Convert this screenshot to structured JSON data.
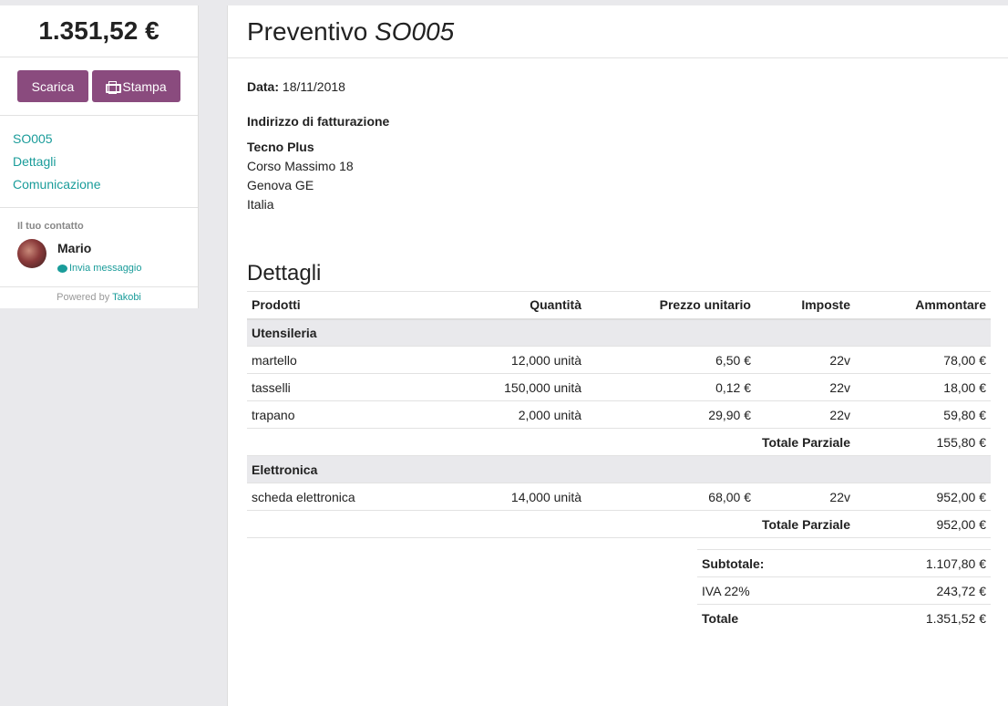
{
  "sidebar": {
    "amount": "1.351,52 €",
    "buttons": {
      "download": "Scarica",
      "print": "Stampa"
    },
    "nav": [
      "SO005",
      "Dettagli",
      "Comunicazione"
    ],
    "contact": {
      "label": "Il tuo contatto",
      "name": "Mario",
      "message": "Invia messaggio"
    },
    "powered": {
      "text": "Powered by",
      "link": "Takobi"
    }
  },
  "header": {
    "prefix": "Preventivo",
    "number": "SO005"
  },
  "info": {
    "date_label": "Data:",
    "date_value": "18/11/2018",
    "billing_title": "Indirizzo di fatturazione",
    "address": {
      "name": "Tecno Plus",
      "street": "Corso Massimo 18",
      "city": "Genova GE",
      "country": "Italia"
    }
  },
  "details": {
    "title": "Dettagli",
    "columns": [
      "Prodotti",
      "Quantità",
      "Prezzo unitario",
      "Imposte",
      "Ammontare"
    ],
    "sections": [
      {
        "name": "Utensileria",
        "rows": [
          {
            "product": "martello",
            "qty": "12,000 unità",
            "price": "6,50 €",
            "tax": "22v",
            "amount": "78,00 €"
          },
          {
            "product": "tasselli",
            "qty": "150,000 unità",
            "price": "0,12 €",
            "tax": "22v",
            "amount": "18,00 €"
          },
          {
            "product": "trapano",
            "qty": "2,000 unità",
            "price": "29,90 €",
            "tax": "22v",
            "amount": "59,80 €"
          }
        ],
        "subtotal_label": "Totale Parziale",
        "subtotal": "155,80 €"
      },
      {
        "name": "Elettronica",
        "rows": [
          {
            "product": "scheda elettronica",
            "qty": "14,000 unità",
            "price": "68,00 €",
            "tax": "22v",
            "amount": "952,00 €"
          }
        ],
        "subtotal_label": "Totale Parziale",
        "subtotal": "952,00 €"
      }
    ]
  },
  "totals": {
    "subtotal_label": "Subtotale:",
    "subtotal": "1.107,80 €",
    "tax_label": "IVA 22%",
    "tax": "243,72 €",
    "total_label": "Totale",
    "total": "1.351,52 €"
  }
}
